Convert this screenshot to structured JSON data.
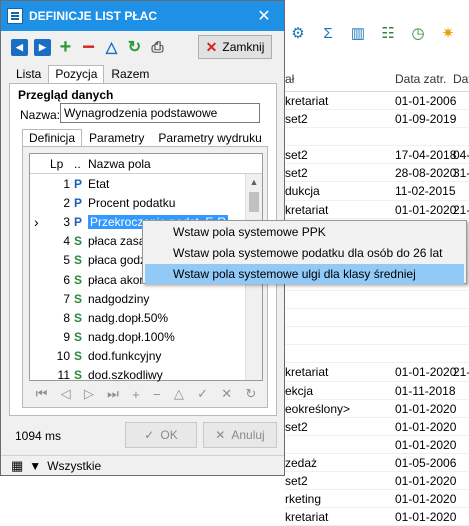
{
  "background": {
    "header": [
      "ał",
      "Data zatr.",
      "Dat"
    ],
    "rows": [
      [
        "kretariat",
        "01-01-2006",
        ""
      ],
      [
        "set2",
        "01-09-2019",
        ""
      ],
      [
        "",
        "",
        ""
      ],
      [
        "set2",
        "17-04-2018",
        "04-"
      ],
      [
        "set2",
        "28-08-2020",
        "31-"
      ],
      [
        "dukcja",
        "11-02-2015",
        ""
      ],
      [
        "kretariat",
        "01-01-2020",
        "21-"
      ],
      [
        "",
        "",
        ""
      ],
      [
        "",
        "",
        ""
      ],
      [
        "",
        "",
        ""
      ],
      [
        "",
        "",
        ""
      ],
      [
        "",
        "",
        ""
      ],
      [
        "",
        "",
        ""
      ],
      [
        "",
        "",
        ""
      ],
      [
        "",
        "",
        ""
      ],
      [
        "kretariat",
        "01-01-2020",
        "21-"
      ],
      [
        "ekcja",
        "01-11-2018",
        ""
      ],
      [
        "eokreślony>",
        "01-01-2020",
        ""
      ],
      [
        "set2",
        "01-01-2020",
        ""
      ],
      [
        "",
        "01-01-2020",
        ""
      ],
      [
        "zedaż",
        "01-05-2006",
        ""
      ],
      [
        "set2",
        "01-01-2020",
        ""
      ],
      [
        "rketing",
        "01-01-2020",
        ""
      ],
      [
        "kretariat",
        "01-01-2020",
        ""
      ]
    ]
  },
  "dialog": {
    "title": "DEFINICJE LIST PŁAC",
    "close_label": "Zamknij",
    "tabs": [
      "Lista",
      "Pozycja",
      "Razem"
    ],
    "section_title": "Przegląd danych",
    "name_label": "Nazwa:",
    "name_value": "Wynagrodzenia podstawowe",
    "inner_tabs": [
      "Definicja",
      "Parametry",
      "Parametry wydruku"
    ],
    "grid": {
      "headers": [
        "Lp",
        "..",
        "Nazwa pola"
      ],
      "rows": [
        {
          "lp": "1",
          "type": "P",
          "name": "Etat"
        },
        {
          "lp": "2",
          "type": "P",
          "name": "Procent podatku"
        },
        {
          "lp": "3",
          "type": "P",
          "name": "Przekroczenie podst. E-R"
        },
        {
          "lp": "4",
          "type": "S",
          "name": "płaca zasadn"
        },
        {
          "lp": "5",
          "type": "S",
          "name": "płaca godzino"
        },
        {
          "lp": "6",
          "type": "S",
          "name": "płaca akordo"
        },
        {
          "lp": "7",
          "type": "S",
          "name": "nadgodziny"
        },
        {
          "lp": "8",
          "type": "S",
          "name": "nadg.dopł.50%"
        },
        {
          "lp": "9",
          "type": "S",
          "name": "nadg.dopł.100%"
        },
        {
          "lp": "10",
          "type": "S",
          "name": "dod.funkcyjny"
        },
        {
          "lp": "11",
          "type": "S",
          "name": "dod.szkodliwy"
        }
      ]
    },
    "time_label": "1094 ms",
    "ok_label": "OK",
    "cancel_label": "Anuluj",
    "filter_label": "Wszystkie"
  },
  "context_menu": {
    "items": [
      "Wstaw pola systemowe PPK",
      "Wstaw pola systemowe podatku dla osób do 26 lat",
      "Wstaw pola systemowe ulgi dla klasy średniej"
    ]
  }
}
